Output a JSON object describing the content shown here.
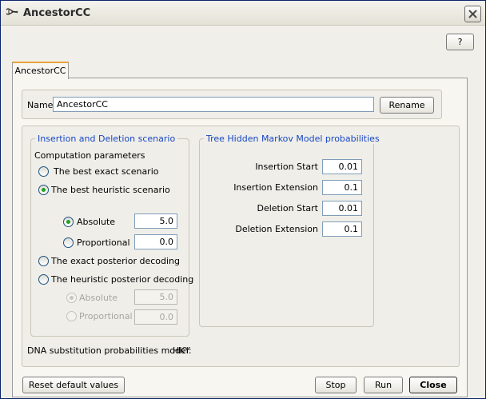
{
  "window": {
    "title": "AncestorCC"
  },
  "help_button": "?",
  "tab": {
    "label": "AncestorCC"
  },
  "name_row": {
    "label": "Name",
    "value": "AncestorCC",
    "rename_button": "Rename"
  },
  "indel": {
    "legend": "Insertion and Deletion scenario",
    "computation_label": "Computation parameters",
    "best_exact": "The best exact scenario",
    "best_heuristic": "The best heuristic scenario",
    "heuristic_absolute": {
      "label": "Absolute",
      "value": "5.0"
    },
    "heuristic_proportional": {
      "label": "Proportional",
      "value": "0.0"
    },
    "exact_posterior": "The exact posterior decoding",
    "heuristic_posterior": "The heuristic posterior decoding",
    "posterior_absolute": {
      "label": "Absolute",
      "value": "5.0"
    },
    "posterior_proportional": {
      "label": "Proportional",
      "value": "0.0"
    },
    "selected": "best_heuristic",
    "heuristic_mode": "absolute"
  },
  "hmm": {
    "legend": "Tree Hidden Markov Model probabilities",
    "insertion_start": {
      "label": "Insertion Start",
      "value": "0.01"
    },
    "insertion_extension": {
      "label": "Insertion Extension",
      "value": "0.1"
    },
    "deletion_start": {
      "label": "Deletion Start",
      "value": "0.01"
    },
    "deletion_extension": {
      "label": "Deletion Extension",
      "value": "0.1"
    }
  },
  "dna_model": {
    "label": "DNA substitution probabilities model:",
    "value": "HKY"
  },
  "buttons": {
    "reset": "Reset default values",
    "stop": "Stop",
    "run": "Run",
    "close": "Close"
  },
  "icons": {
    "app": "dna-helix-icon",
    "close": "close-x-icon"
  },
  "colors": {
    "accent": "#1646c4",
    "radio_selected": "#21a121",
    "tab_highlight": "#e8a33c"
  }
}
